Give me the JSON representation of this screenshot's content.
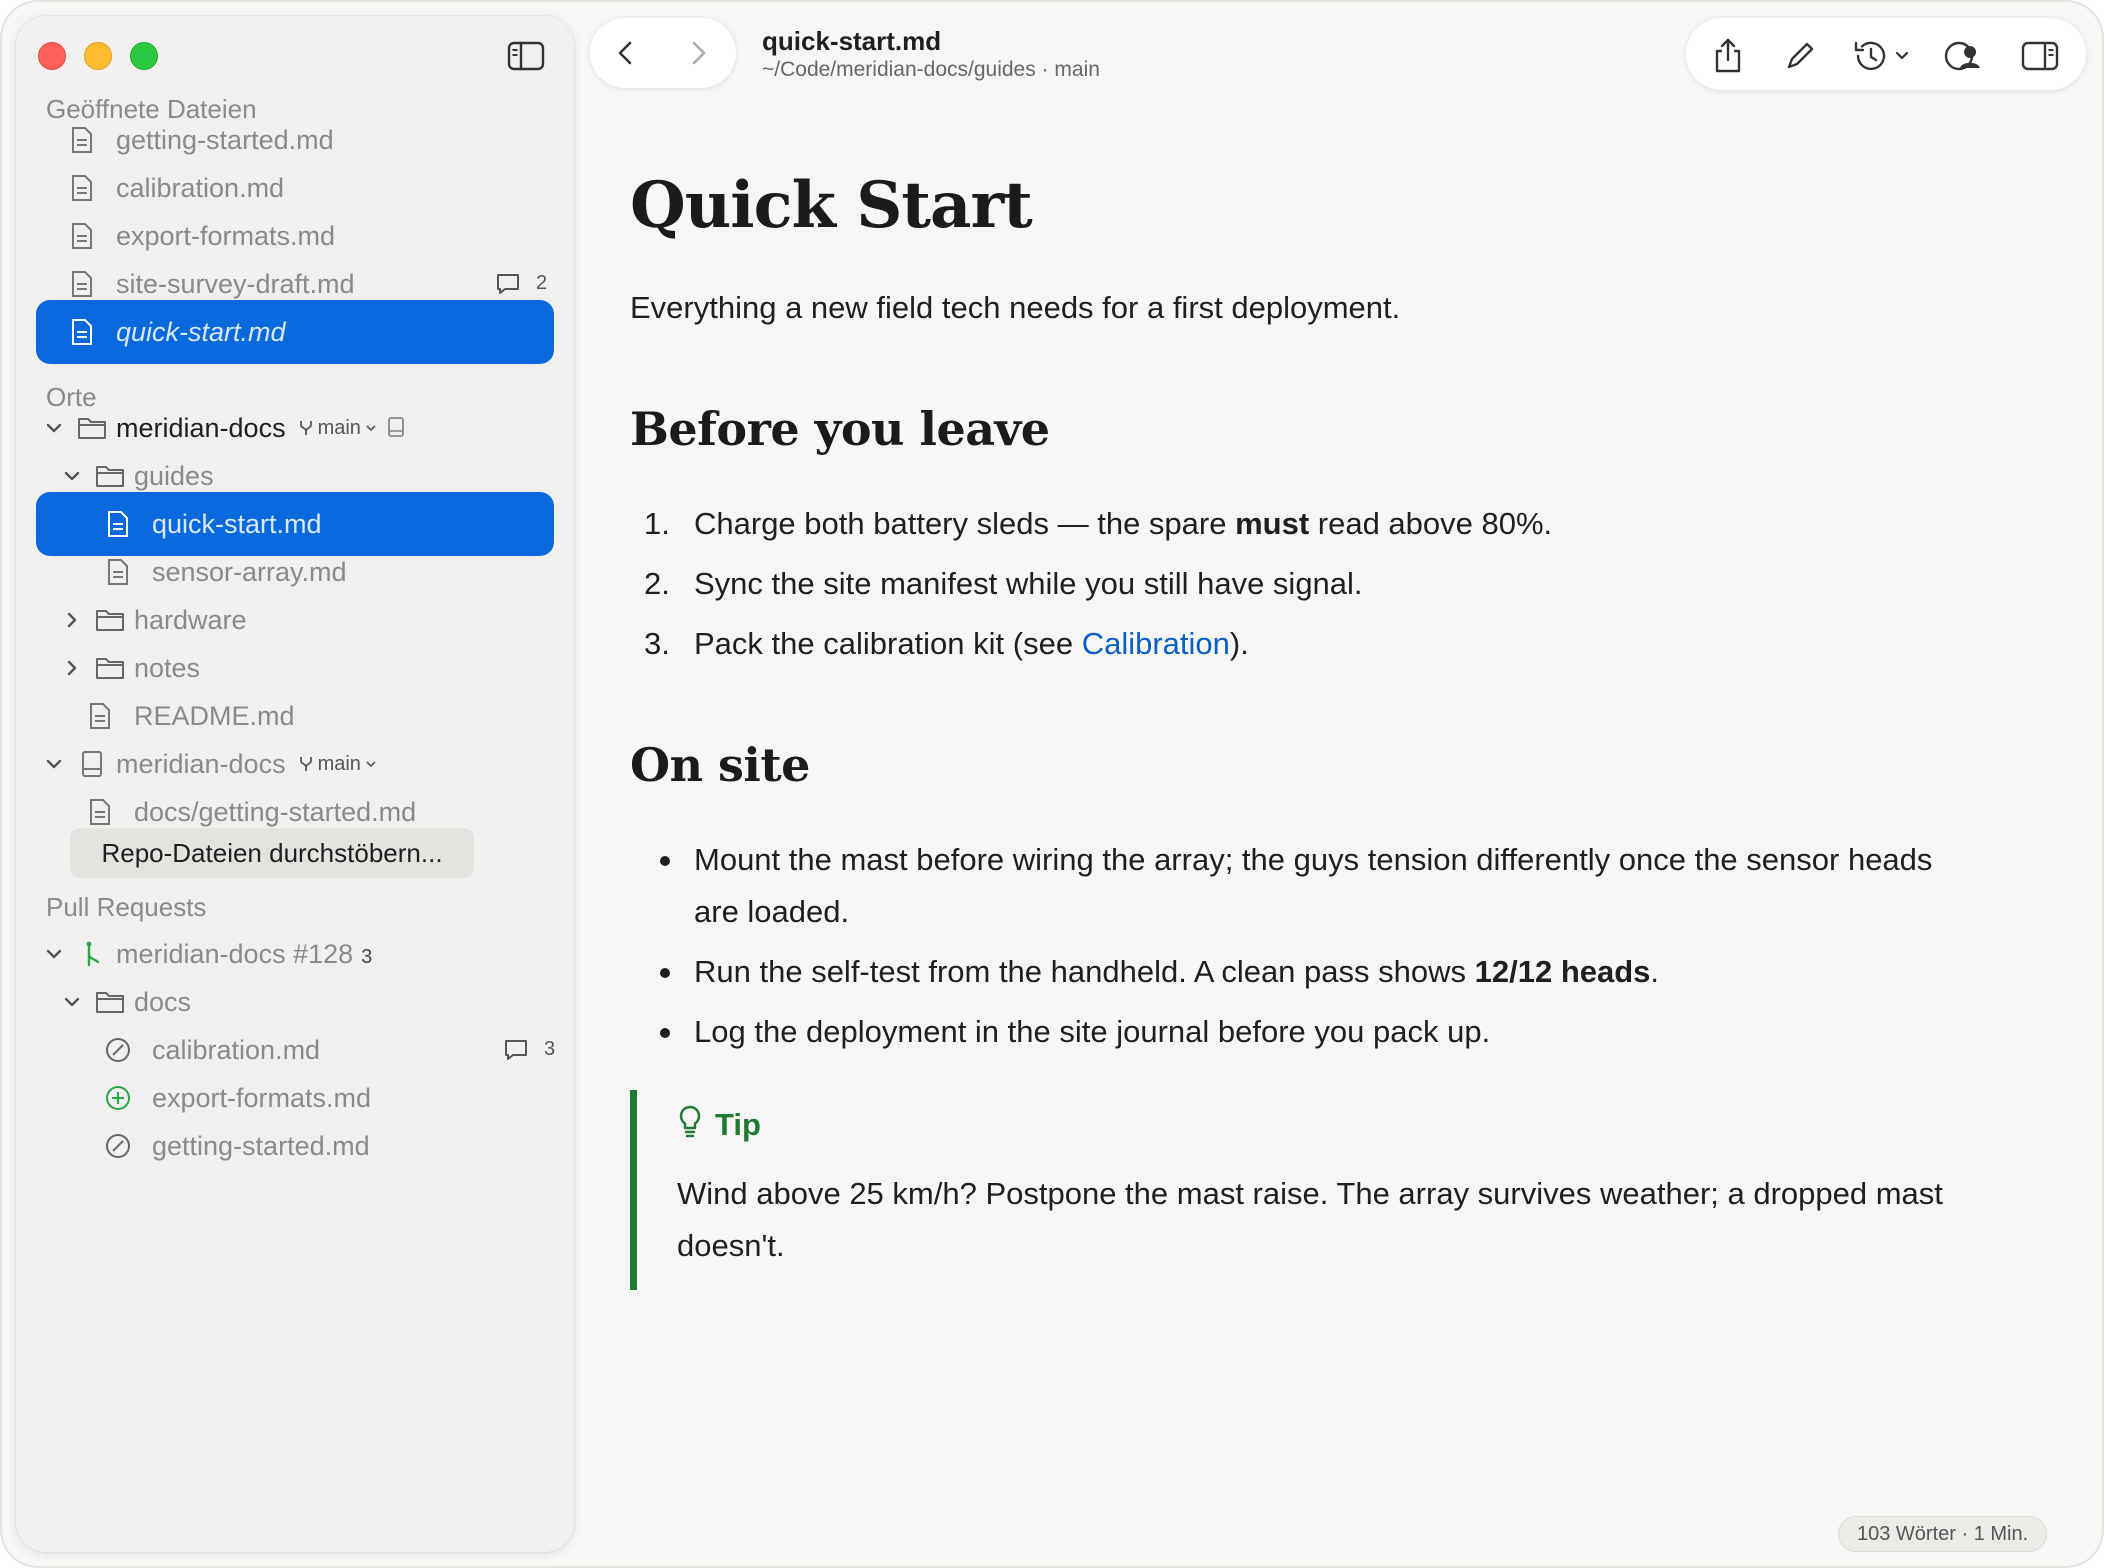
{
  "window": {
    "title": "quick-start.md",
    "subtitle": "~/Code/meridian-docs/guides · main"
  },
  "sidebar": {
    "open_files_title": "Geöffnete Dateien",
    "open_files": [
      {
        "label": "getting-started.md"
      },
      {
        "label": "calibration.md"
      },
      {
        "label": "export-formats.md"
      },
      {
        "label": "site-survey-draft.md",
        "comments": "2"
      },
      {
        "label": "quick-start.md",
        "selected": true
      }
    ],
    "places_title": "Orte",
    "repo1": {
      "label": "meridian-docs",
      "branch": "main"
    },
    "guides": {
      "label": "guides"
    },
    "guides_files": [
      {
        "label": "quick-start.md",
        "selected": true
      },
      {
        "label": "sensor-array.md"
      }
    ],
    "hardware": {
      "label": "hardware"
    },
    "notes": {
      "label": "notes"
    },
    "readme": {
      "label": "README.md"
    },
    "repo2": {
      "label": "meridian-docs",
      "branch": "main"
    },
    "repo2_file": {
      "label": "docs/getting-started.md"
    },
    "browse_button": "Repo-Dateien durchstöbern...",
    "prs_title": "Pull Requests",
    "pr": {
      "label": "meridian-docs #128",
      "count": "3"
    },
    "pr_docs": {
      "label": "docs"
    },
    "pr_files": [
      {
        "label": "calibration.md",
        "status": "modified",
        "comments": "3"
      },
      {
        "label": "export-formats.md",
        "status": "added"
      },
      {
        "label": "getting-started.md",
        "status": "modified"
      }
    ]
  },
  "doc": {
    "h1": "Quick Start",
    "lead": "Everything a new field tech needs for a first deployment.",
    "section1": {
      "title": "Before you leave",
      "items": [
        {
          "num": "1.",
          "pre": "Charge both battery sleds — the spare ",
          "bold": "must",
          "post": " read above 80%."
        },
        {
          "num": "2.",
          "text": "Sync the site manifest while you still have signal."
        },
        {
          "num": "3.",
          "pre": "Pack the calibration kit (see ",
          "link": "Calibration",
          "post": ")."
        }
      ]
    },
    "section2": {
      "title": "On site",
      "items": [
        {
          "text": "Mount the mast before wiring the array; the guys tension differently once the sensor heads are loaded."
        },
        {
          "pre": "Run the self-test from the handheld. A clean pass shows ",
          "bold": "12/12 heads",
          "post": "."
        },
        {
          "text": "Log the deployment in the site journal before you pack up."
        }
      ]
    },
    "tip": {
      "title": "Tip",
      "body": "Wind above 25 km/h? Postpone the mast raise. The array survives weather; a dropped mast doesn't."
    }
  },
  "status": {
    "word_count": "103 Wörter · 1 Min."
  },
  "colors": {
    "accent": "#0869dd",
    "link": "#0a5fc4",
    "tip": "#1f7a34",
    "added": "#28a745"
  }
}
